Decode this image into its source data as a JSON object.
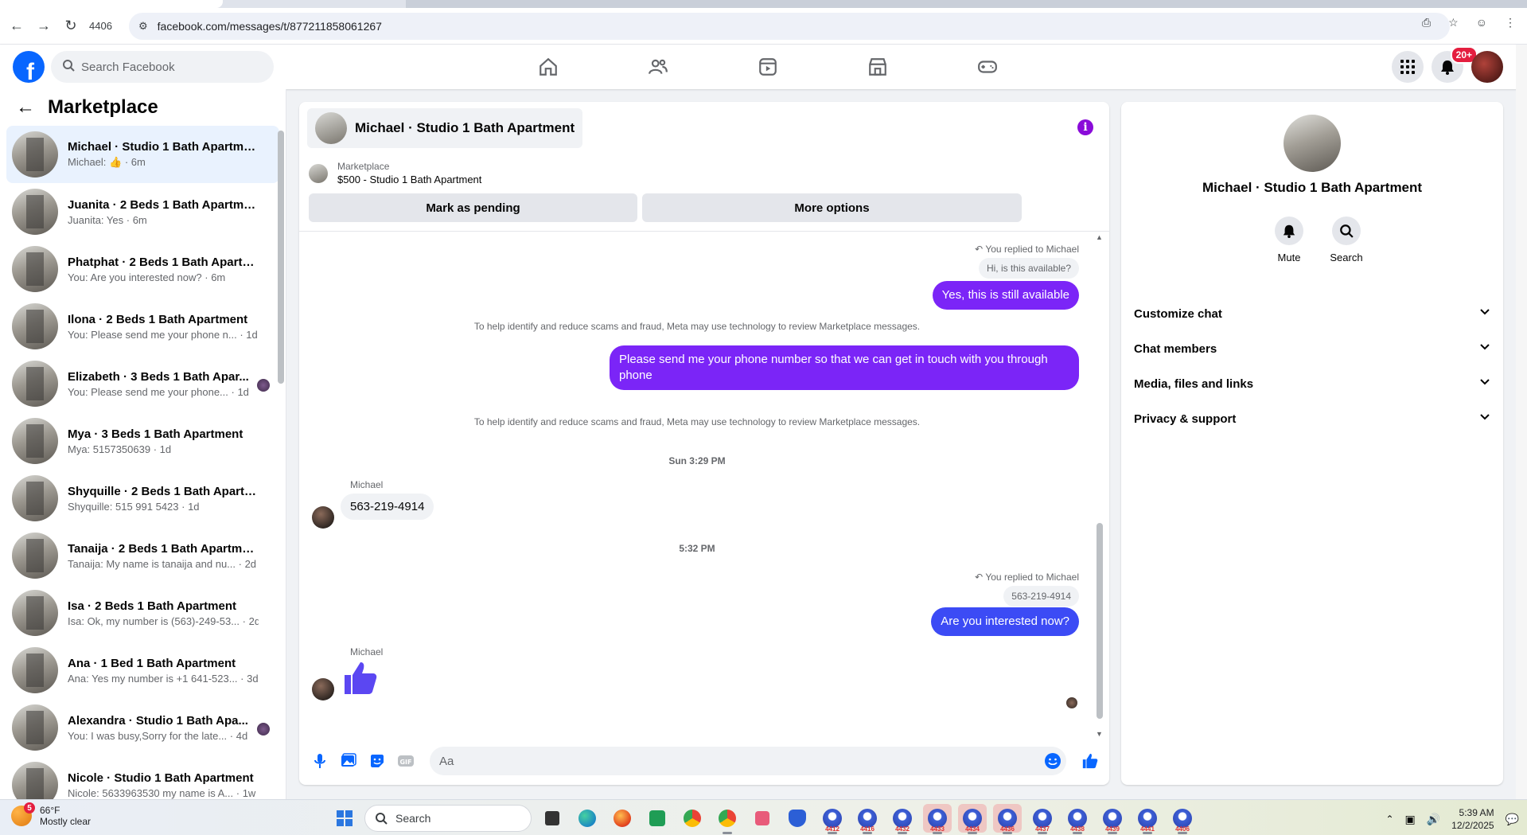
{
  "browser": {
    "tab_count": "4406",
    "url": "facebook.com/messages/t/877211858061267"
  },
  "fb": {
    "search_placeholder": "Search Facebook",
    "notifications_badge": "20+",
    "brand_color": "#0866ff"
  },
  "sidebar": {
    "title": "Marketplace",
    "conversations": [
      {
        "name": "Michael · Studio 1 Bath Apartment",
        "preview": "Michael:",
        "time": "6m",
        "active": true,
        "has_like": true
      },
      {
        "name": "Juanita · 2 Beds 1 Bath Apartment",
        "preview": "Juanita: Yes",
        "time": "6m"
      },
      {
        "name": "Phatphat · 2 Beds 1 Bath Apartm...",
        "preview": "You: Are you interested now?",
        "time": "6m"
      },
      {
        "name": "Ilona · 2 Beds 1 Bath Apartment",
        "preview": "You: Please send me your phone n...",
        "time": "1d"
      },
      {
        "name": "Elizabeth · 3 Beds 1 Bath Apar...",
        "preview": "You: Please send me your phone...",
        "time": "1d",
        "seen_avatar": true
      },
      {
        "name": "Mya · 3 Beds 1 Bath Apartment",
        "preview": "Mya: 5157350639",
        "time": "1d"
      },
      {
        "name": "Shyquille · 2 Beds 1 Bath Apartm...",
        "preview": "Shyquille: 515 991 5423",
        "time": "1d"
      },
      {
        "name": "Tanaija · 2 Beds 1 Bath Apartment",
        "preview": "Tanaija: My name is tanaija and nu...",
        "time": "2d"
      },
      {
        "name": "Isa · 2 Beds 1 Bath Apartment",
        "preview": "Isa: Ok, my number is (563)-249-53...",
        "time": "2d"
      },
      {
        "name": "Ana · 1 Bed 1 Bath Apartment",
        "preview": "Ana: Yes my number is +1 641-523...",
        "time": "3d"
      },
      {
        "name": "Alexandra · Studio 1 Bath Apa...",
        "preview": "You: I was busy,Sorry for the late...",
        "time": "4d",
        "seen_avatar": true
      },
      {
        "name": "Nicole · Studio 1 Bath Apartment",
        "preview": "Nicole: 5633963530 my name is A...",
        "time": "1w"
      }
    ]
  },
  "chat": {
    "header_title": "Michael · Studio 1 Bath Apartment",
    "listing_source": "Marketplace",
    "listing_title": "$500 - Studio 1 Bath Apartment",
    "mark_pending_label": "Mark as pending",
    "more_options_label": "More options",
    "composer_placeholder": "Aa",
    "accent_color": "#7b25f7",
    "messages": {
      "reply1_label": "You replied to Michael",
      "reply1_quote": "Hi, is this available?",
      "out1": "Yes, this is still available",
      "notice1": "To help identify and reduce scams and fraud, Meta may use technology to review Marketplace messages.",
      "out2": "Please send me your phone  number so that we can get in touch with you through phone",
      "notice2": "To help identify and reduce scams and fraud, Meta may use technology to review Marketplace messages.",
      "ts1": "Sun 3:29 PM",
      "sender1": "Michael",
      "in1": "563-219-4914",
      "ts2": "5:32 PM",
      "reply2_label": "You replied to Michael",
      "reply2_quote": "563-219-4914",
      "out3": "Are you interested now?",
      "sender2": "Michael",
      "in2_icon": "thumbs-up-icon"
    }
  },
  "details": {
    "title": "Michael · Studio 1 Bath Apartment",
    "mute_label": "Mute",
    "search_label": "Search",
    "sections": [
      "Customize chat",
      "Chat members",
      "Media, files and links",
      "Privacy & support"
    ]
  },
  "taskbar": {
    "weather_badge": "5",
    "temp": "66°F",
    "condition": "Mostly clear",
    "search_label": "Search",
    "app_numbers": [
      "4412",
      "4416",
      "4432",
      "4433",
      "4434",
      "4436",
      "4437",
      "4438",
      "4439",
      "4441",
      "4406"
    ],
    "time": "5:39 AM",
    "date": "12/2/2025"
  }
}
